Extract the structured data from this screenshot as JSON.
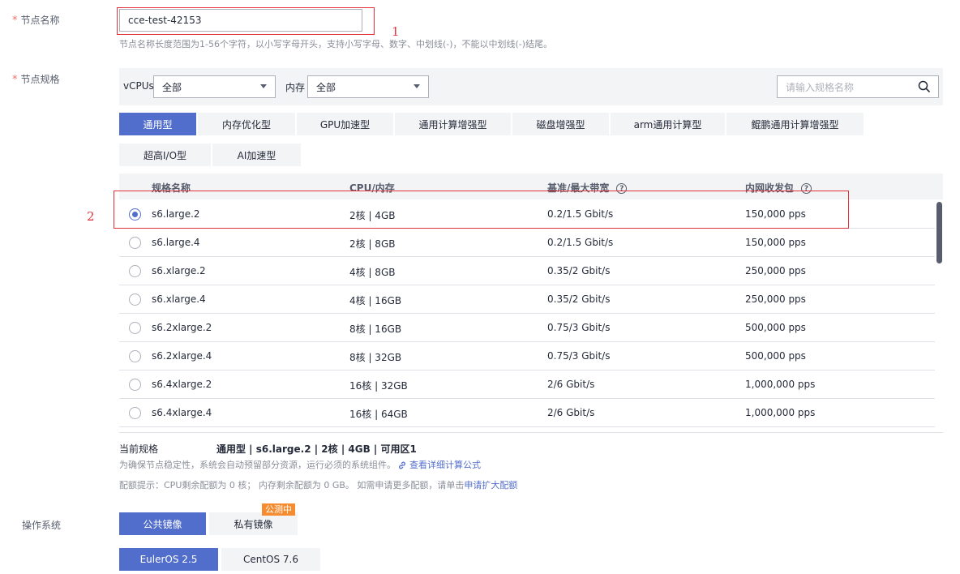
{
  "node_name": {
    "label": "节点名称",
    "value": "cce-test-42153",
    "hint": "节点名称长度范围为1-56个字符，以小写字母开头，支持小写字母、数字、中划线(-)，不能以中划线(-)结尾。"
  },
  "annotations": {
    "one": "1",
    "two": "2"
  },
  "node_spec": {
    "label": "节点规格",
    "vcpus_label": "vCPUs",
    "vcpus_value": "全部",
    "memory_label": "内存",
    "memory_value": "全部",
    "search_placeholder": "请输入规格名称"
  },
  "tabs": [
    {
      "label": "通用型",
      "active": true
    },
    {
      "label": "内存优化型"
    },
    {
      "label": "GPU加速型"
    },
    {
      "label": "通用计算增强型"
    },
    {
      "label": "磁盘增强型"
    },
    {
      "label": "arm通用计算型"
    },
    {
      "label": "鲲鹏通用计算增强型"
    },
    {
      "label": "超高I/O型"
    },
    {
      "label": "AI加速型"
    }
  ],
  "table": {
    "headers": [
      "规格名称",
      "CPU/内存",
      "基准/最大带宽",
      "内网收发包"
    ],
    "rows": [
      {
        "name": "s6.large.2",
        "cpu": "2核 | 4GB",
        "bw": "0.2/1.5 Gbit/s",
        "pps": "150,000 pps",
        "selected": true
      },
      {
        "name": "s6.large.4",
        "cpu": "2核 | 8GB",
        "bw": "0.2/1.5 Gbit/s",
        "pps": "150,000 pps"
      },
      {
        "name": "s6.xlarge.2",
        "cpu": "4核 | 8GB",
        "bw": "0.35/2 Gbit/s",
        "pps": "250,000 pps"
      },
      {
        "name": "s6.xlarge.4",
        "cpu": "4核 | 16GB",
        "bw": "0.35/2 Gbit/s",
        "pps": "250,000 pps"
      },
      {
        "name": "s6.2xlarge.2",
        "cpu": "8核 | 16GB",
        "bw": "0.75/3 Gbit/s",
        "pps": "500,000 pps"
      },
      {
        "name": "s6.2xlarge.4",
        "cpu": "8核 | 32GB",
        "bw": "0.75/3 Gbit/s",
        "pps": "500,000 pps"
      },
      {
        "name": "s6.4xlarge.2",
        "cpu": "16核 | 32GB",
        "bw": "2/6 Gbit/s",
        "pps": "1,000,000 pps"
      },
      {
        "name": "s6.4xlarge.4",
        "cpu": "16核 | 64GB",
        "bw": "2/6 Gbit/s",
        "pps": "1,000,000 pps"
      }
    ]
  },
  "current_spec": {
    "label": "当前规格",
    "value": "通用型 | s6.large.2 | 2核 | 4GB | 可用区1",
    "note": "为确保节点稳定性，系统会自动预留部分资源，运行必须的系统组件。",
    "note_link": "查看详细计算公式",
    "quota": "配额提示：CPU剩余配额为 0 核； 内存剩余配额为 0 GB。 如需申请更多配额，请单击",
    "quota_link": "申请扩大配额"
  },
  "os": {
    "label": "操作系统",
    "image_tabs": [
      "公共镜像",
      "私有镜像"
    ],
    "badge": "公测中",
    "versions": [
      "EulerOS 2.5",
      "CentOS 7.6"
    ]
  },
  "colors": {
    "accent": "#526ecc",
    "required": "#f66f6a",
    "annotation": "#e3303b",
    "badge": "#f58c2f"
  }
}
